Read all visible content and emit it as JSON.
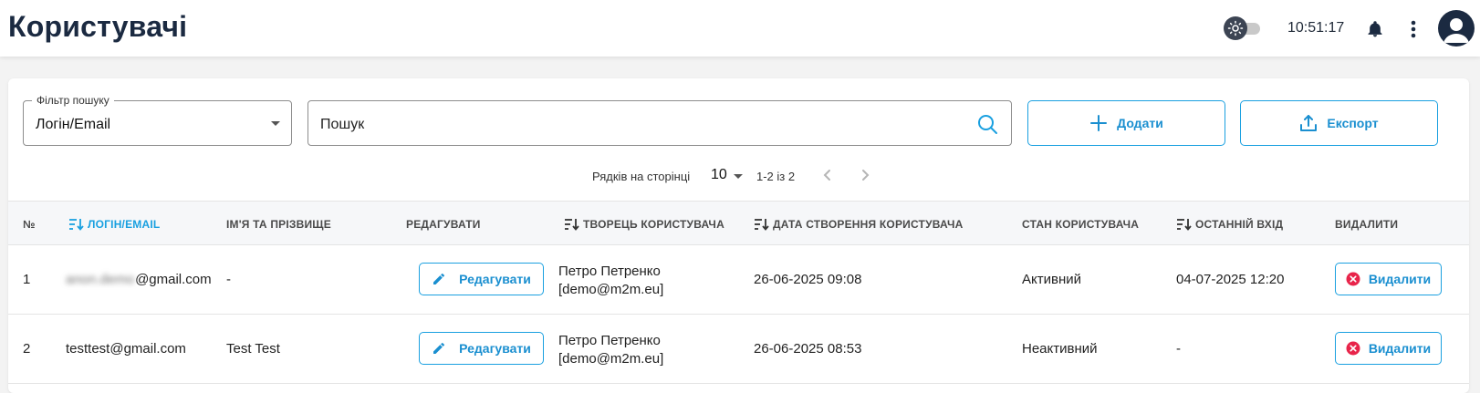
{
  "header": {
    "title": "Користувачі",
    "time": "10:51:17"
  },
  "toolbar": {
    "filter_legend": "Фільтр пошуку",
    "filter_value": "Логін/Email",
    "search_placeholder": "Пошук",
    "add_label": "Додати",
    "export_label": "Експорт"
  },
  "pagination": {
    "rows_label": "Рядків на сторінці",
    "rows_value": "10",
    "range": "1-2 із 2"
  },
  "table": {
    "columns": [
      "№",
      "Логін/Email",
      "Ім'я та прізвище",
      "Редагувати",
      "Творець користувача",
      "Дата створення користувача",
      "Стан користувача",
      "Останній вхід",
      "Видалити"
    ],
    "edit_label": "Редагувати",
    "delete_label": "Видалити",
    "rows": [
      {
        "num": "1",
        "login_hidden": "anon.demo",
        "login": "@gmail.com",
        "name": "-",
        "creator_name": "Петро Петренко",
        "creator_email": "[demo@m2m.eu]",
        "created": "26-06-2025 09:08",
        "status": "Активний",
        "last_login": "04-07-2025 12:20"
      },
      {
        "num": "2",
        "login_hidden": "",
        "login": "testtest@gmail.com",
        "name": "Test Test",
        "creator_name": "Петро Петренко",
        "creator_email": "[demo@m2m.eu]",
        "created": "26-06-2025 08:53",
        "status": "Неактивний",
        "last_login": "-"
      }
    ]
  },
  "colors": {
    "accent": "#1aa0e0",
    "title": "#1b2a41",
    "delete_icon": "#e8244a"
  }
}
